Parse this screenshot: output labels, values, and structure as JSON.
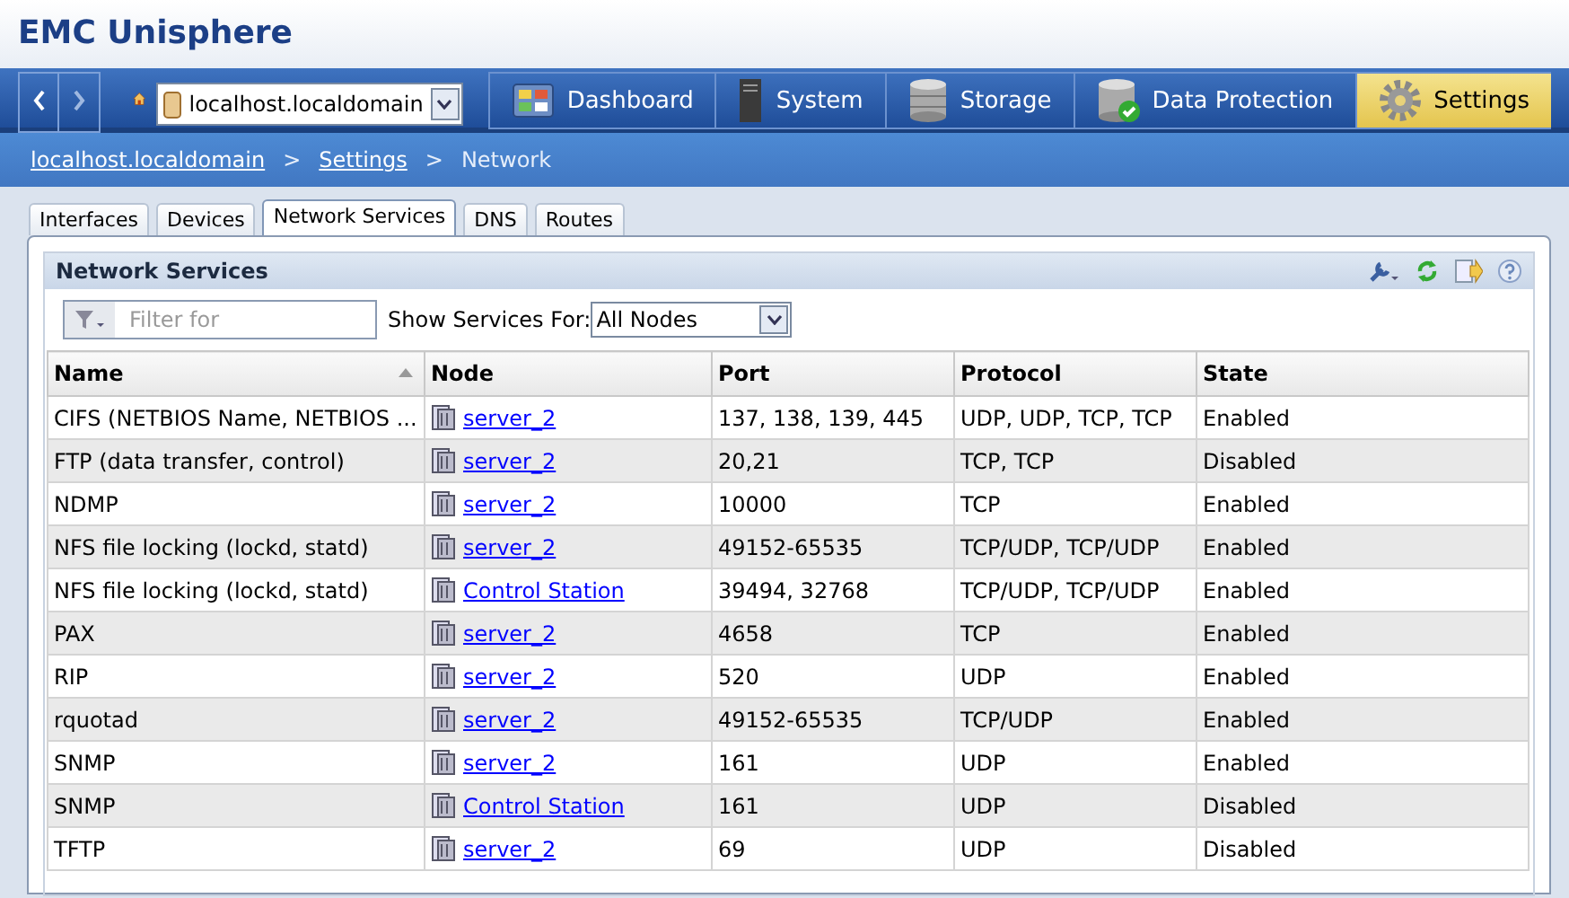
{
  "app": {
    "title": "EMC Unisphere"
  },
  "nav": {
    "host": "localhost.localdomain",
    "items": [
      {
        "label": "Dashboard",
        "kind": "dashboard",
        "selected": false
      },
      {
        "label": "System",
        "kind": "system",
        "selected": false
      },
      {
        "label": "Storage",
        "kind": "storage",
        "selected": false
      },
      {
        "label": "Data Protection",
        "kind": "protection",
        "selected": false
      },
      {
        "label": "Settings",
        "kind": "settings",
        "selected": true
      }
    ]
  },
  "breadcrumb": [
    {
      "label": "localhost.localdomain",
      "link": true
    },
    {
      "label": ">",
      "link": false
    },
    {
      "label": "Settings",
      "link": true
    },
    {
      "label": ">",
      "link": false
    },
    {
      "label": "Network",
      "link": false
    }
  ],
  "tabs": [
    {
      "label": "Interfaces",
      "selected": false
    },
    {
      "label": "Devices",
      "selected": false
    },
    {
      "label": "Network Services",
      "selected": true
    },
    {
      "label": "DNS",
      "selected": false
    },
    {
      "label": "Routes",
      "selected": false
    }
  ],
  "panel": {
    "title": "Network Services",
    "filter": {
      "placeholder": "Filter for"
    },
    "show_label": "Show Services For:",
    "show_value": "All Nodes"
  },
  "table": {
    "columns": [
      {
        "label": "Name",
        "sorted": true
      },
      {
        "label": "Node",
        "sorted": false
      },
      {
        "label": "Port",
        "sorted": false
      },
      {
        "label": "Protocol",
        "sorted": false
      },
      {
        "label": "State",
        "sorted": false
      }
    ],
    "rows": [
      {
        "name": "CIFS (NETBIOS Name, NETBIOS ...",
        "node": "server_2",
        "port": "137, 138, 139, 445",
        "protocol": "UDP, UDP, TCP, TCP",
        "state": "Enabled"
      },
      {
        "name": "FTP (data transfer, control)",
        "node": "server_2",
        "port": "20,21",
        "protocol": "TCP, TCP",
        "state": "Disabled"
      },
      {
        "name": "NDMP",
        "node": "server_2",
        "port": "10000",
        "protocol": "TCP",
        "state": "Enabled"
      },
      {
        "name": "NFS file locking (lockd, statd)",
        "node": "server_2",
        "port": "49152-65535",
        "protocol": "TCP/UDP, TCP/UDP",
        "state": "Enabled"
      },
      {
        "name": "NFS file locking (lockd, statd)",
        "node": "Control Station",
        "port": "39494, 32768",
        "protocol": "TCP/UDP, TCP/UDP",
        "state": "Enabled"
      },
      {
        "name": "PAX",
        "node": "server_2",
        "port": "4658",
        "protocol": "TCP",
        "state": "Enabled"
      },
      {
        "name": "RIP",
        "node": "server_2",
        "port": "520",
        "protocol": "UDP",
        "state": "Enabled"
      },
      {
        "name": "rquotad",
        "node": "server_2",
        "port": "49152-65535",
        "protocol": "TCP/UDP",
        "state": "Enabled"
      },
      {
        "name": "SNMP",
        "node": "server_2",
        "port": "161",
        "protocol": "UDP",
        "state": "Enabled"
      },
      {
        "name": "SNMP",
        "node": "Control Station",
        "port": "161",
        "protocol": "UDP",
        "state": "Disabled"
      },
      {
        "name": "TFTP",
        "node": "server_2",
        "port": "69",
        "protocol": "UDP",
        "state": "Disabled"
      }
    ]
  }
}
